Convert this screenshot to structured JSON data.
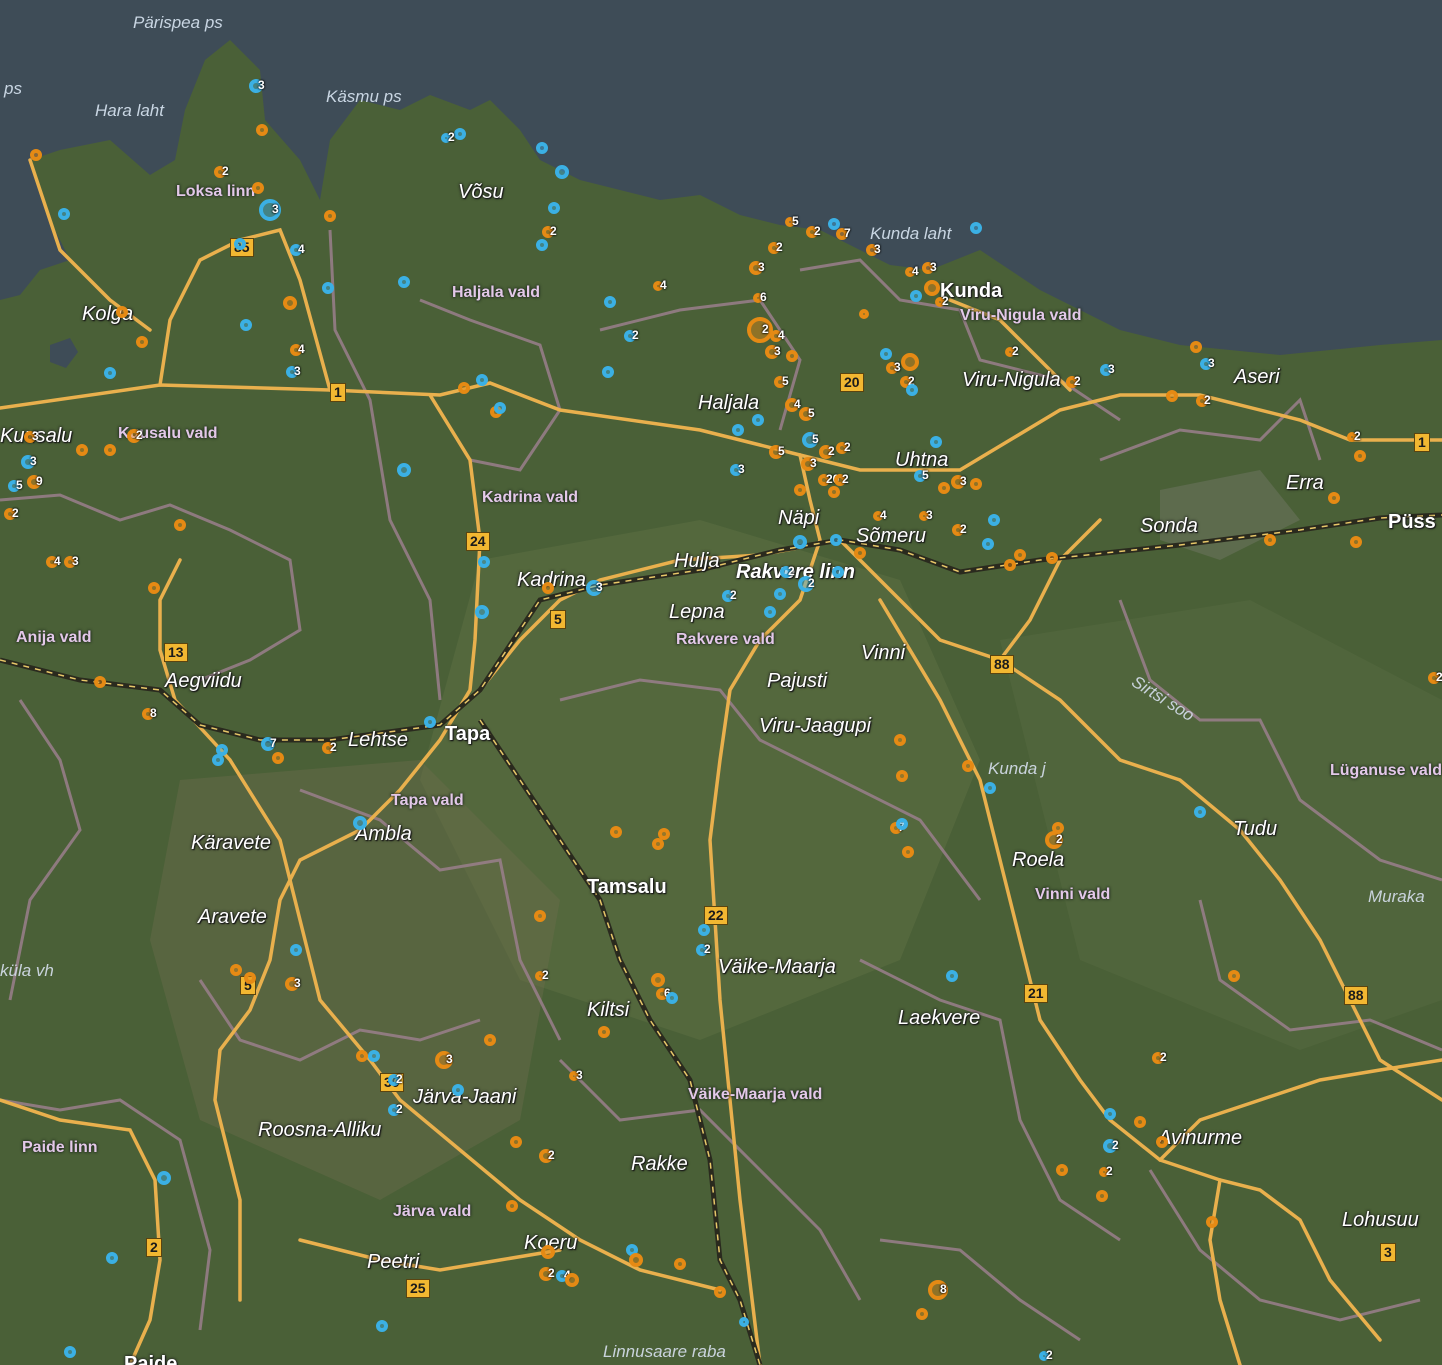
{
  "places": {
    "kunda": "Kunda",
    "rakvere": "Rakvere linn",
    "tapa": "Tapa",
    "tamsalu": "Tamsalu",
    "pussi": "Püss",
    "paide": "Paide",
    "haljala": "Haljala",
    "vosu": "Võsu",
    "kolga": "Kolga",
    "napi": "Näpi",
    "someru": "Sõmeru",
    "hulja": "Hulja",
    "kadrina": "Kadrina",
    "lepna": "Lepna",
    "vinni": "Vinni",
    "pajusti": "Pajusti",
    "viru_jaagupi": "Viru-Jaagupi",
    "aegviidu": "Aegviidu",
    "lehtse": "Lehtse",
    "ambla": "Ambla",
    "karavete": "Käravete",
    "aravete": "Aravete",
    "uhtna": "Uhtna",
    "sonda": "Sonda",
    "erra": "Erra",
    "aseri": "Aseri",
    "viru_nigula": "Viru-Nigula",
    "tudu": "Tudu",
    "roela": "Roela",
    "vaike_maarja": "Väike-Maarja",
    "kiltsi": "Kiltsi",
    "laekvere": "Laekvere",
    "jarva_jaani": "Järva-Jaani",
    "roosna_alliku": "Roosna-Alliku",
    "rakke": "Rakke",
    "avinurme": "Avinurme",
    "lohusuu": "Lohusuu",
    "koeru": "Koeru",
    "peetri": "Peetri",
    "kuusalu": "Kuusalu"
  },
  "municipalities": {
    "loksa": "Loksa linn",
    "haljala_vald": "Haljala vald",
    "viru_nigula_vald": "Viru-Nigula vald",
    "kuusalu_vald": "Kuusalu vald",
    "kadrina_vald": "Kadrina vald",
    "anija_vald": "Anija vald",
    "rakvere_vald": "Rakvere vald",
    "tapa_vald": "Tapa vald",
    "vinni_vald": "Vinni vald",
    "luganuse_vald": "Lüganuse vald",
    "vaike_maarja_vald": "Väike-Maarja vald",
    "paide_linn": "Paide linn",
    "jarva_vald": "Järva vald",
    "kula_vald": "küla vh"
  },
  "water": {
    "parispea": "Pärispea ps",
    "kasmu": "Käsmu ps",
    "hara": "Hara laht",
    "kunda_laht": "Kunda laht",
    "juminda": "ps",
    "kunda_jogi": "Kunda j",
    "sirtsi": "Sirtsi soo",
    "muraka": "Muraka",
    "linnusaare": "Linnusaare raba"
  },
  "roads": [
    "1",
    "85",
    "20",
    "13",
    "24",
    "5",
    "88",
    "22",
    "21",
    "30",
    "2",
    "25",
    "3"
  ],
  "colors": {
    "sea": "#3e4c57",
    "land": "#4c6138",
    "road": "#e9b04d",
    "boundary": "#9a7f8c",
    "marker_orange": "#e58a14",
    "marker_blue": "#3bb0e4"
  },
  "marker_counts": [
    "3",
    "2",
    "3",
    "4",
    "4",
    "3",
    "3",
    "2",
    "3",
    "9",
    "5",
    "2",
    "4",
    "3",
    "2",
    "2",
    "2",
    "4",
    "5",
    "2",
    "7",
    "2",
    "3",
    "6",
    "2",
    "4",
    "3",
    "5",
    "4",
    "5",
    "5",
    "2",
    "2",
    "3",
    "20",
    "2",
    "5",
    "3",
    "3",
    "2",
    "5",
    "3",
    "4",
    "3",
    "2",
    "3",
    "2",
    "2",
    "3",
    "3",
    "2",
    "2",
    "4",
    "3",
    "2",
    "2",
    "2",
    "2",
    "2",
    "3",
    "8",
    "7",
    "2",
    "2",
    "6",
    "2",
    "3",
    "3",
    "7",
    "2",
    "2",
    "2",
    "2",
    "8",
    "2",
    "3",
    "2",
    "2",
    "2",
    "2",
    "4"
  ]
}
